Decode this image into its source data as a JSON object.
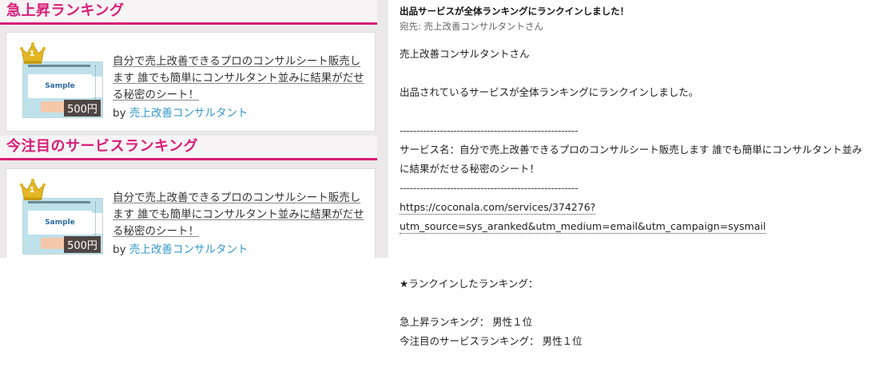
{
  "left_panel": {
    "sections": [
      {
        "heading": "急上昇ランキング",
        "card": {
          "rank": "1",
          "thumbnail_label": "Sample",
          "price": "500円",
          "title": "自分で売上改善できるプロのコンサルシート販売します 誰でも簡単にコンサルタント並みに結果がだせる秘密のシート！",
          "by_label": "by",
          "seller": "売上改善コンサルタント"
        }
      },
      {
        "heading": "今注目のサービスランキング",
        "card": {
          "rank": "1",
          "thumbnail_label": "Sample",
          "price": "500円",
          "title": "自分で売上改善できるプロのコンサルシート販売します 誰でも簡単にコンサルタント並みに結果がだせる秘密のシート！",
          "by_label": "by",
          "seller": "売上改善コンサルタント"
        }
      }
    ]
  },
  "email": {
    "subject": "出品サービスが全体ランキングにランクインしました！",
    "to_label": "宛先:",
    "to_value": "売上改善コンサルタントさん",
    "greeting": "売上改善コンサルタントさん",
    "intro": "出品されているサービスが全体ランキングにランクインしました。",
    "divider": "-----------------------------------------------------",
    "service_line": "サービス名：自分で売上改善できるプロのコンサルシート販売します 誰でも簡単にコンサルタント並みに結果がだせる秘密のシート！",
    "link_line1": "https://coconala.com/services/374276?",
    "link_line2": "utm_source=sys_aranked&utm_medium=email&utm_campaign=sysmail",
    "ranked_heading": "★ランクインしたランキング：",
    "rankings": [
      "急上昇ランキング： 男性１位",
      "今注目のサービスランキング： 男性１位"
    ]
  },
  "colors": {
    "accent": "#d81d78",
    "link": "#3497c9",
    "crown_gold": "#e3b724",
    "price_badge": "#443836"
  },
  "icons": {
    "crown": "crown-icon"
  }
}
